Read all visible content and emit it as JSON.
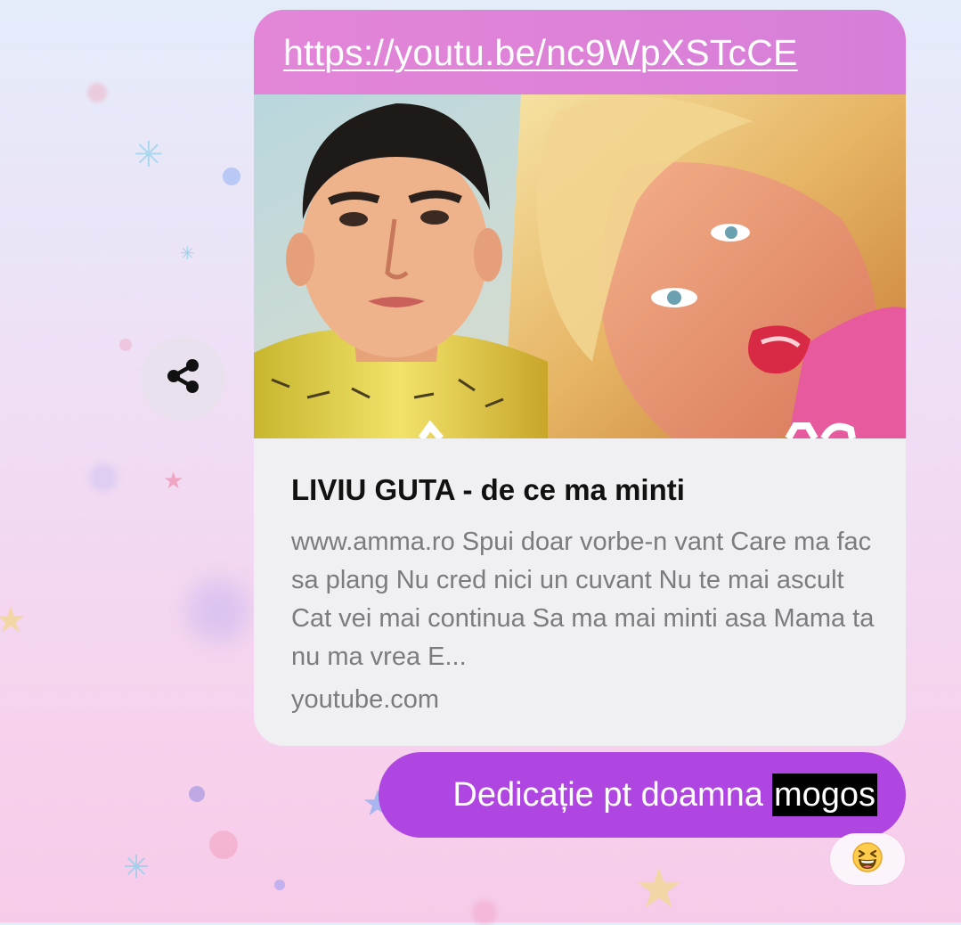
{
  "link_preview": {
    "url": "https://youtu.be/nc9WpXSTcCE",
    "title": "LIVIU GUTA - de ce ma minti",
    "description": "www.amma.ro Spui doar vorbe-n vant Care ma fac sa plang Nu cred nici un cuvant Nu te mai ascult Cat vei mai continua Sa ma mai minti asa Mama ta nu ma vrea E...",
    "domain": "youtube.com",
    "thumbnail_icon": "video-thumbnail"
  },
  "share_button": {
    "icon": "share-icon"
  },
  "message": {
    "text": "Dedicație pt doamna",
    "highlighted_word": "mogos"
  },
  "reaction": {
    "emoji": "😆"
  },
  "colors": {
    "url_bar": "#dd82d7",
    "preview_card": "#f0eff1",
    "sent_bubble": "#b046e1",
    "share_button_bg": "#e9e2ee"
  }
}
